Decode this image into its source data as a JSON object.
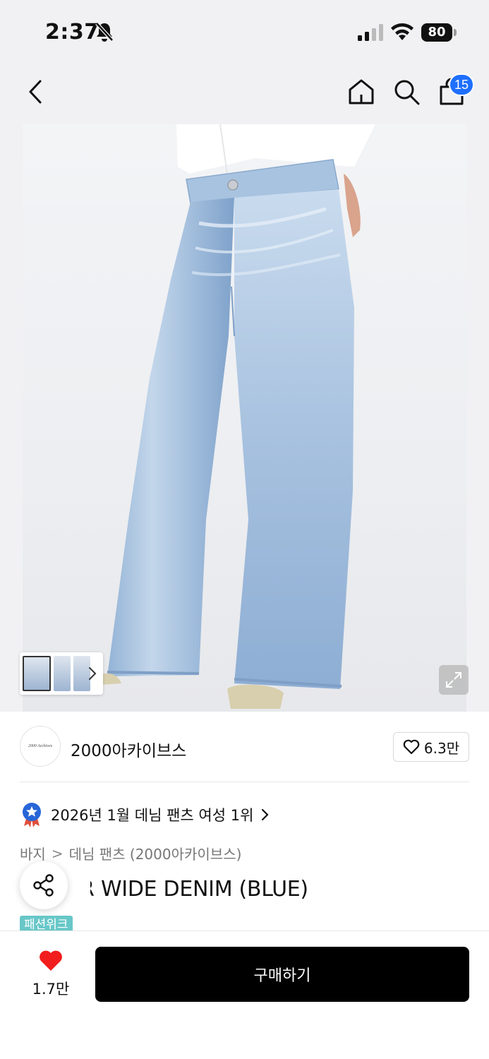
{
  "status_bar": {
    "time": "2:37",
    "battery": "80"
  },
  "nav": {
    "cart_count": "15"
  },
  "brand": {
    "logo_text": "2000 Archives",
    "name": "2000아카이브스",
    "likes": "6.3만"
  },
  "ranking": {
    "text": "2026년 1월 데님 팬츠 여성 1위"
  },
  "breadcrumb": {
    "category": "바지",
    "separator": ">",
    "subcategory": "데님 팬츠 (2000아카이브스)"
  },
  "product": {
    "title": "SLIDER WIDE DENIM (BLUE)",
    "event_badge": "패션위크"
  },
  "bottom_bar": {
    "wish_count": "1.7만",
    "buy_label": "구매하기"
  },
  "colors": {
    "accent_blue": "#1f6fff",
    "heart_red": "#f21d1d",
    "badge_teal": "#68c7c8",
    "buy_button": "#000000"
  }
}
